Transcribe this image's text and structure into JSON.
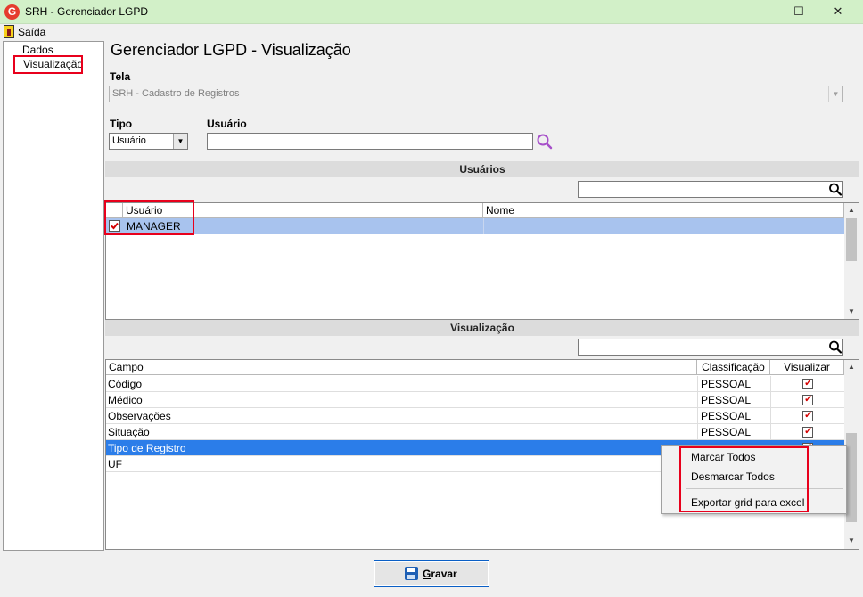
{
  "window": {
    "title": "SRH - Gerenciador LGPD",
    "icon": "app-logo-icon",
    "accent": "#d2f0c8"
  },
  "menu": {
    "items": [
      {
        "label": "Saída"
      }
    ]
  },
  "tree": {
    "items": [
      {
        "label": "Dados"
      },
      {
        "label": "Visualização",
        "selected": true
      }
    ]
  },
  "page": {
    "title": "Gerenciador LGPD - Visualização"
  },
  "form": {
    "tela": {
      "label": "Tela",
      "value": "SRH - Cadastro de Registros",
      "disabled": true
    },
    "tipo": {
      "label": "Tipo",
      "value": "Usuário"
    },
    "usuario": {
      "label": "Usuário",
      "value": ""
    }
  },
  "users_section": {
    "title": "Usuários",
    "filter_value": "",
    "columns": [
      "Usuário",
      "Nome"
    ],
    "rows": [
      {
        "checked": true,
        "usuario": "MANAGER",
        "nome": ""
      }
    ]
  },
  "visualizacao_section": {
    "title": "Visualização",
    "filter_value": "",
    "columns": [
      "Campo",
      "Classificação",
      "Visualizar"
    ],
    "rows": [
      {
        "campo": "Código",
        "classificacao": "PESSOAL",
        "visualizar": true
      },
      {
        "campo": "Médico",
        "classificacao": "PESSOAL",
        "visualizar": true
      },
      {
        "campo": "Observações",
        "classificacao": "PESSOAL",
        "visualizar": true
      },
      {
        "campo": "Situação",
        "classificacao": "PESSOAL",
        "visualizar": true
      },
      {
        "campo": "Tipo de Registro",
        "classificacao": "",
        "visualizar": true,
        "selected": true
      },
      {
        "campo": "UF",
        "classificacao": "",
        "visualizar": false
      }
    ]
  },
  "context_menu": {
    "items": [
      "Marcar Todos",
      "Desmarcar Todos",
      "Exportar grid para excel"
    ]
  },
  "footer": {
    "save_label": "Gravar"
  },
  "colors": {
    "highlight": "#e8001c",
    "selected_row": "#2b7de9",
    "user_row": "#a8c3ee"
  }
}
